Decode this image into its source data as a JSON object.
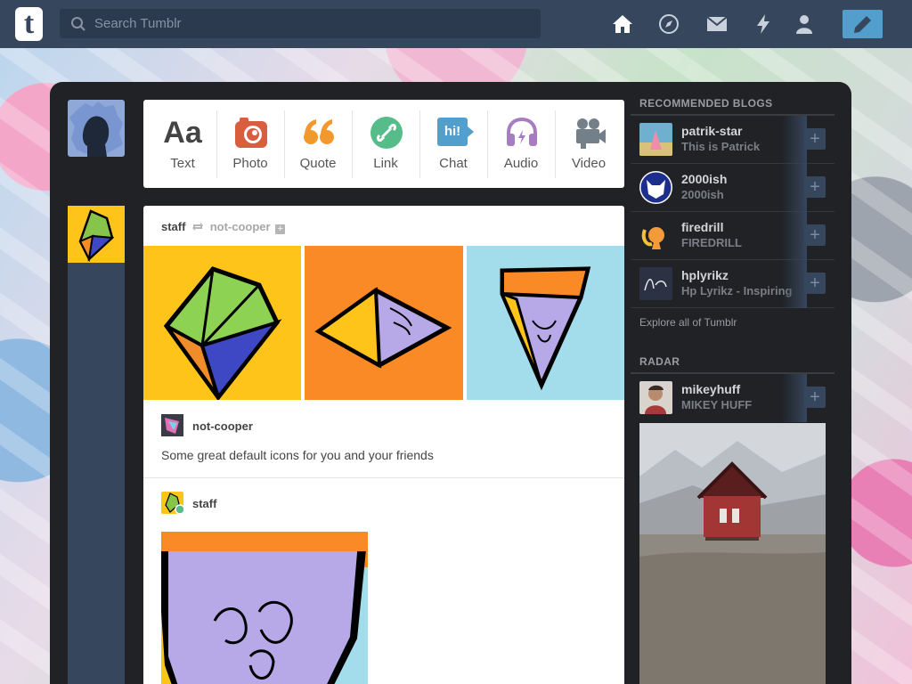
{
  "header": {
    "logo": "t",
    "search_placeholder": "Search Tumblr"
  },
  "colors": {
    "nav": "#36465d",
    "accent": "#529ecc",
    "panel": "#202226"
  },
  "post_types": [
    {
      "label": "Text",
      "icon": "text-icon",
      "glyph": "Aa"
    },
    {
      "label": "Photo",
      "icon": "camera-icon"
    },
    {
      "label": "Quote",
      "icon": "quote-icon"
    },
    {
      "label": "Link",
      "icon": "link-icon"
    },
    {
      "label": "Chat",
      "icon": "chat-icon",
      "glyph": "hi!"
    },
    {
      "label": "Audio",
      "icon": "headphones-icon"
    },
    {
      "label": "Video",
      "icon": "video-camera-icon"
    }
  ],
  "post": {
    "author": "staff",
    "reblogged_from": "not-cooper",
    "reblog1_user": "not-cooper",
    "reblog1_text": "Some great default icons for you and your friends",
    "reblog2_user": "staff"
  },
  "sidebar": {
    "recommended_title": "RECOMMENDED BLOGS",
    "blogs": [
      {
        "name": "patrik-star",
        "title": "This is Patrick"
      },
      {
        "name": "2000ish",
        "title": "2000ish"
      },
      {
        "name": "firedrill",
        "title": "FIREDRILL"
      },
      {
        "name": "hplyrikz",
        "title": "Hp Lyrikz - Inspiring"
      }
    ],
    "explore": "Explore all of Tumblr",
    "radar_title": "RADAR",
    "radar": {
      "name": "mikeyhuff",
      "title": "MIKEY HUFF"
    }
  }
}
